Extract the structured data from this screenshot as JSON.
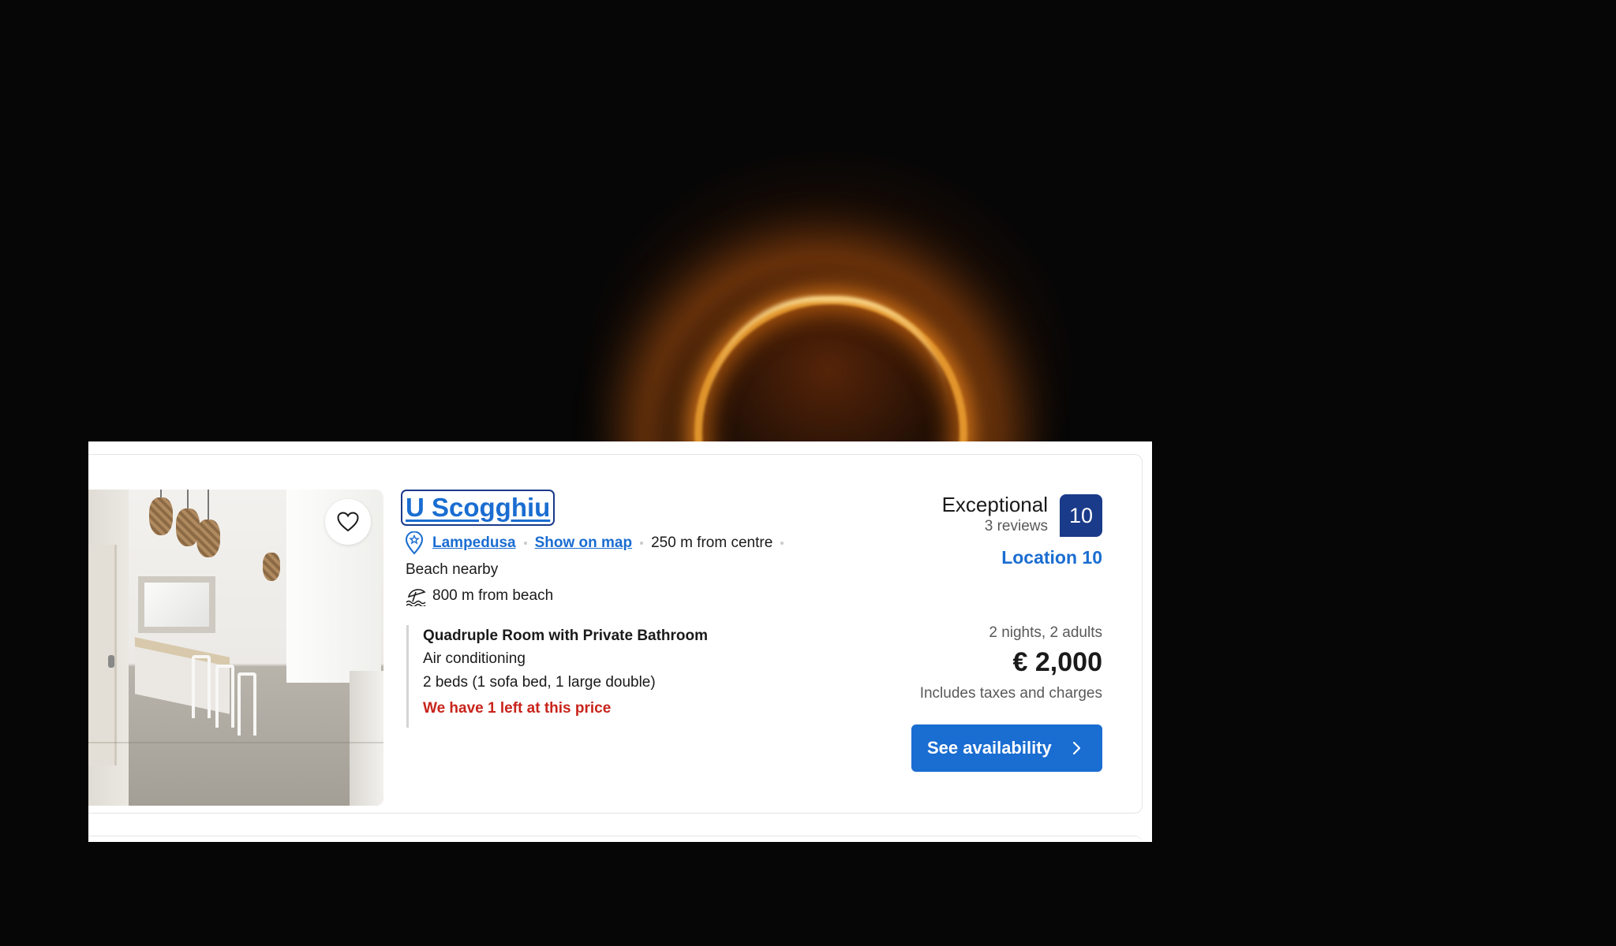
{
  "listing": {
    "title": "U Scogghiu",
    "favorite_icon": "heart-outline-icon",
    "location": {
      "pin_icon": "map-pin-icon",
      "town": "Lampedusa",
      "map_link": "Show on map",
      "distance_centre": "250 m from centre"
    },
    "beach_nearby": "Beach nearby",
    "beach_icon": "beach-umbrella-icon",
    "beach_distance": "800 m from beach",
    "room": {
      "name": "Quadruple Room with Private Bathroom",
      "amenity": "Air conditioning",
      "beds": "2 beds (1 sofa bed, 1 large double)",
      "scarcity": "We have 1 left at this price"
    },
    "rating": {
      "label": "Exceptional",
      "reviews": "3 reviews",
      "score": "10",
      "location_score": "Location 10"
    },
    "pricing": {
      "stay": "2 nights, 2 adults",
      "price": "€ 2,000",
      "taxes_note": "Includes taxes and charges"
    },
    "cta": {
      "label": "See availability",
      "icon": "chevron-right-icon"
    }
  },
  "colors": {
    "link": "#1a6dd1",
    "badge": "#1a3a8a",
    "warning": "#c8241b",
    "muted": "#595959"
  }
}
